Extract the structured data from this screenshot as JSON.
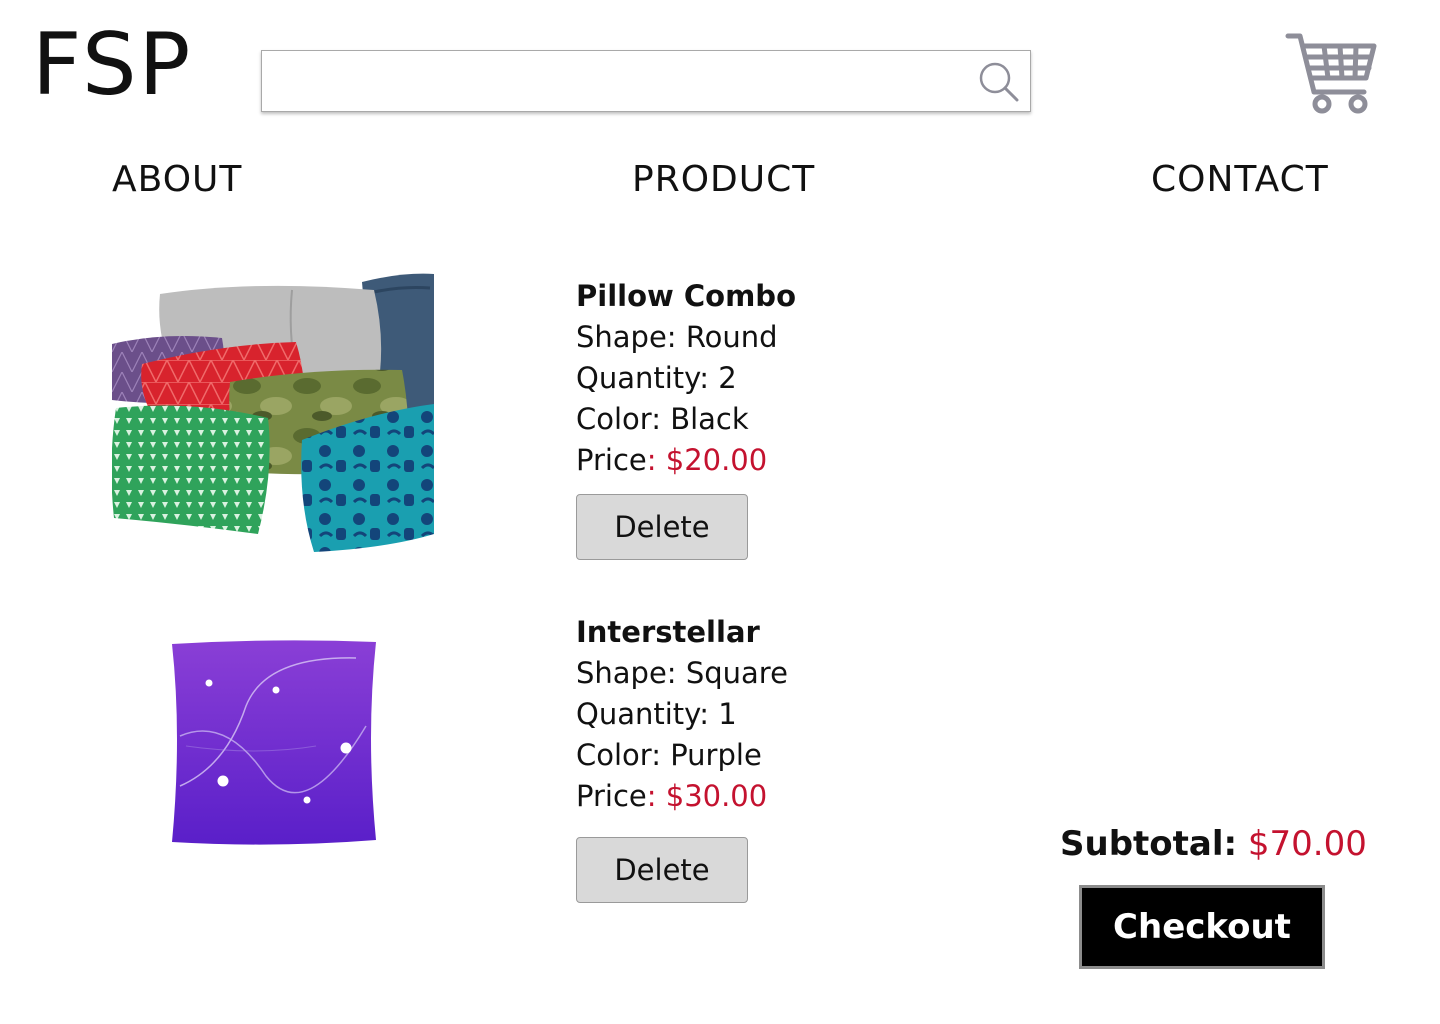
{
  "header": {
    "logo": "FSP",
    "search": {
      "value": "",
      "placeholder": ""
    },
    "search_icon": "magnifier-icon",
    "cart_icon": "shopping-cart-icon"
  },
  "nav": {
    "items": [
      {
        "label": "ABOUT"
      },
      {
        "label": "PRODUCT"
      },
      {
        "label": "CONTACT"
      }
    ]
  },
  "cart": {
    "items": [
      {
        "name": "Pillow Combo",
        "shape_label": "Shape: ",
        "shape": "Round",
        "quantity_label": "Quantity: ",
        "quantity": "2",
        "color_label": "Color: ",
        "color": "Black",
        "price_label": "Price",
        "price": ": $20.00",
        "delete_label": "Delete",
        "image": "assorted-pillows-image"
      },
      {
        "name": "Interstellar",
        "shape_label": "Shape: ",
        "shape": "Square",
        "quantity_label": "Quantity: ",
        "quantity": "1",
        "color_label": "Color: ",
        "color": "Purple",
        "price_label": "Price",
        "price": ": $30.00",
        "delete_label": "Delete",
        "image": "purple-constellation-pillow-image"
      }
    ],
    "subtotal_label": "Subtotal:",
    "subtotal_value": "$70.00",
    "checkout_label": "Checkout"
  },
  "colors": {
    "price": "#c4122f",
    "checkout_bg": "#000000",
    "delete_bg": "#d9d9d9",
    "icon_gray": "#8e8e99"
  }
}
